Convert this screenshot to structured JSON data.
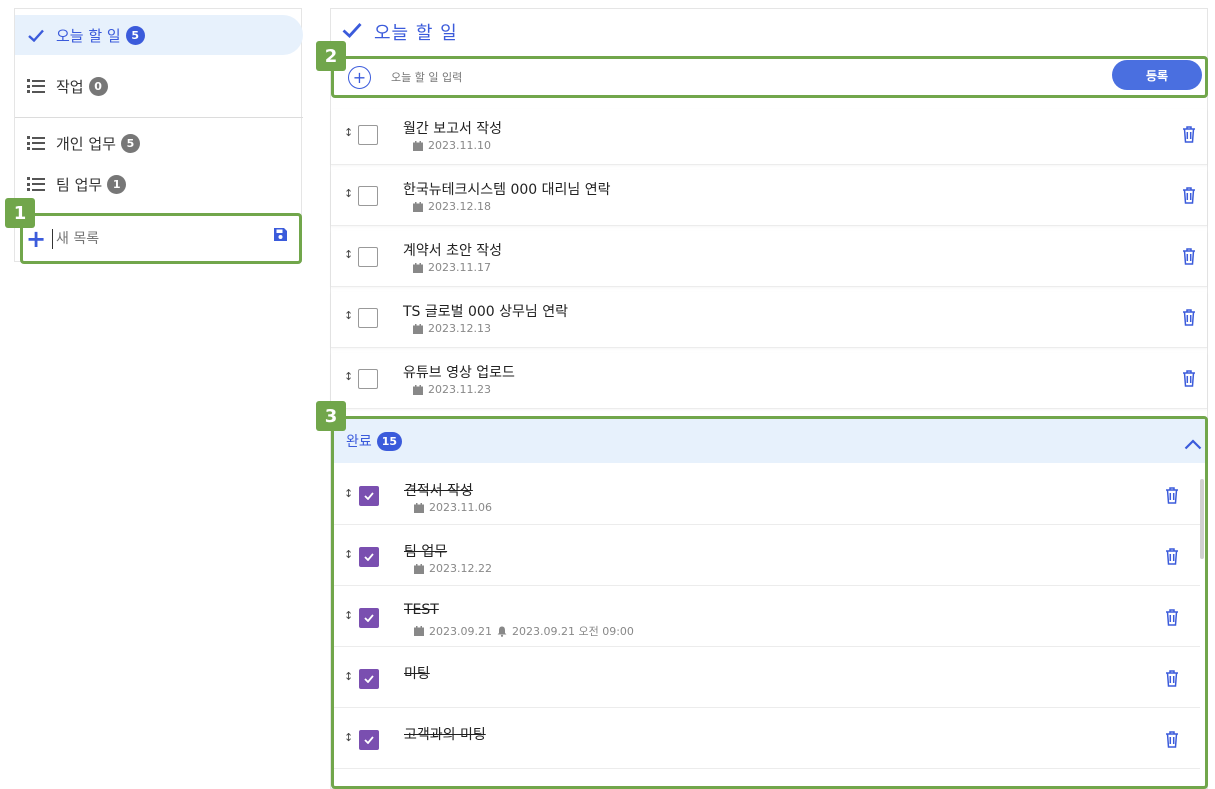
{
  "sidebar": {
    "items": [
      {
        "label": "오늘 할 일",
        "count": "5",
        "icon": "check-icon"
      },
      {
        "label": "작업",
        "count": "0",
        "icon": "list-icon"
      },
      {
        "label": "개인 업무",
        "count": "5",
        "icon": "list-icon"
      },
      {
        "label": "팀 업무",
        "count": "1",
        "icon": "list-icon"
      }
    ],
    "new_list_placeholder": "새 목록"
  },
  "badges": {
    "b1": "1",
    "b2": "2",
    "b3": "3"
  },
  "main": {
    "title": "오늘 할 일",
    "add_placeholder": "오늘 할 일 입력",
    "register_label": "등록",
    "tasks": [
      {
        "name": "월간 보고서 작성",
        "date": "2023.11.10"
      },
      {
        "name": "한국뉴테크시스템 000 대리님 연락",
        "date": "2023.12.18"
      },
      {
        "name": "계약서 초안 작성",
        "date": "2023.11.17"
      },
      {
        "name": "TS 글로벌 000 상무님 연락",
        "date": "2023.12.13"
      },
      {
        "name": "유튜브 영상 업로드",
        "date": "2023.11.23"
      }
    ],
    "done": {
      "label": "완료",
      "count": "15",
      "tasks": [
        {
          "name": "견적서 작성",
          "date": "2023.11.06"
        },
        {
          "name": "팀 업무",
          "date": "2023.12.22"
        },
        {
          "name": "TEST",
          "date": "2023.09.21",
          "reminder": "2023.09.21 오전 09:00"
        },
        {
          "name": "미팅",
          "date": ""
        },
        {
          "name": "고객과의 미팅",
          "date": ""
        }
      ]
    }
  },
  "colors": {
    "accent": "#3b5bdb",
    "highlight": "#71a64b",
    "done_check": "#7a4fb0",
    "active_bg": "#e7f1fc"
  }
}
